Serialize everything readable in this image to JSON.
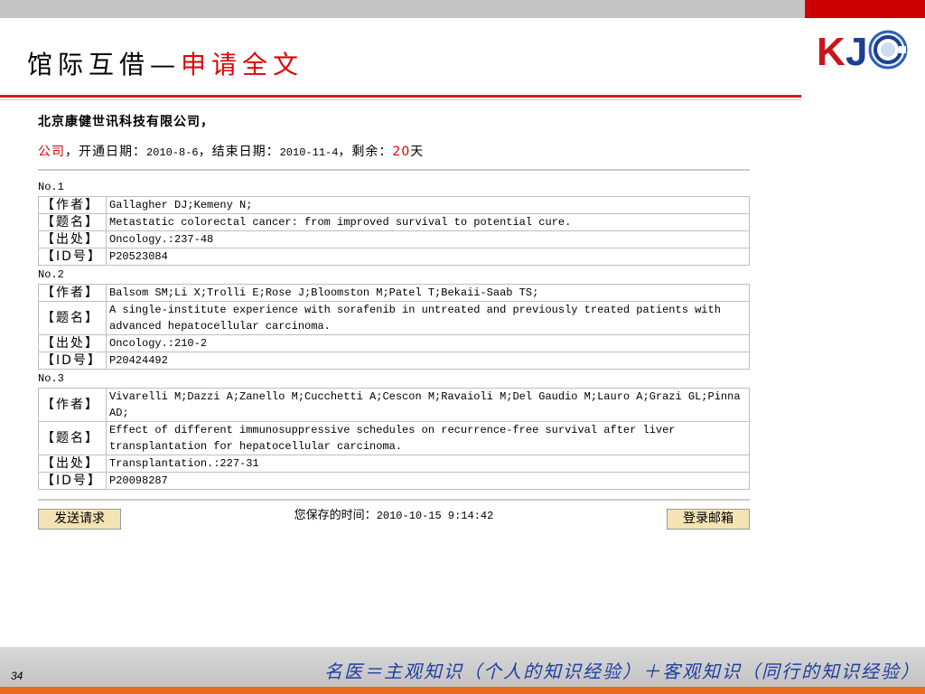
{
  "slide": {
    "title_prefix": "馆际互借—",
    "title_highlight": "申请全文",
    "page_number": "34",
    "footer_slogan": "名医＝主观知识（个人的知识经验）＋客观知识（同行的知识经验）"
  },
  "logo": {
    "letter_k": "K",
    "letter_j": "J",
    "icon": "concentric-ring-icon"
  },
  "account": {
    "company_label": "北京康健世讯科技有限公司，",
    "org": "公司",
    "open_label": "，开通日期：",
    "open_date": "2010-8-6",
    "end_label": "，结束日期：",
    "end_date": "2010-11-4",
    "remaining_label": "，剩余：",
    "remaining_days": "20",
    "days_unit": "天"
  },
  "records": [
    {
      "no": "No.1",
      "fields": [
        {
          "label": "【作者】",
          "value": "Gallagher DJ;Kemeny N;"
        },
        {
          "label": "【题名】",
          "value": "Metastatic colorectal cancer: from improved survival to potential cure."
        },
        {
          "label": "【出处】",
          "value": "Oncology.:237-48"
        },
        {
          "label": "【ID号】",
          "value": "P20523084"
        }
      ]
    },
    {
      "no": "No.2",
      "fields": [
        {
          "label": "【作者】",
          "value": "Balsom SM;Li X;Trolli E;Rose J;Bloomston M;Patel T;Bekaii-Saab TS;"
        },
        {
          "label": "【题名】",
          "value": "A single-institute experience with sorafenib in untreated and previously treated patients with advanced hepatocellular carcinoma."
        },
        {
          "label": "【出处】",
          "value": "Oncology.:210-2"
        },
        {
          "label": "【ID号】",
          "value": "P20424492"
        }
      ]
    },
    {
      "no": "No.3",
      "fields": [
        {
          "label": "【作者】",
          "value": "Vivarelli M;Dazzi A;Zanello M;Cucchetti A;Cescon M;Ravaioli M;Del Gaudio M;Lauro A;Grazi GL;Pinna AD;"
        },
        {
          "label": "【题名】",
          "value": "Effect of different immunosuppressive schedules on recurrence-free survival after liver transplantation for hepatocellular carcinoma."
        },
        {
          "label": "【出处】",
          "value": "Transplantation.:227-31"
        },
        {
          "label": "【ID号】",
          "value": "P20098287"
        }
      ]
    }
  ],
  "actions": {
    "send_request_label": "发送请求",
    "login_mail_label": "登录邮箱"
  },
  "saved_time": {
    "label": "您保存的时间：",
    "value": "2010-10-15 9:14:42"
  },
  "colors": {
    "accent_red": "#e00000",
    "top_bar_red": "#cc0000",
    "top_bar_gray": "#c4c4c4",
    "button_beige": "#f4e3b4",
    "footer_blue": "#1f3f9f",
    "footer_orange": "#ea6a1f",
    "logo_red": "#c8161d",
    "logo_blue": "#1d3f8f"
  }
}
